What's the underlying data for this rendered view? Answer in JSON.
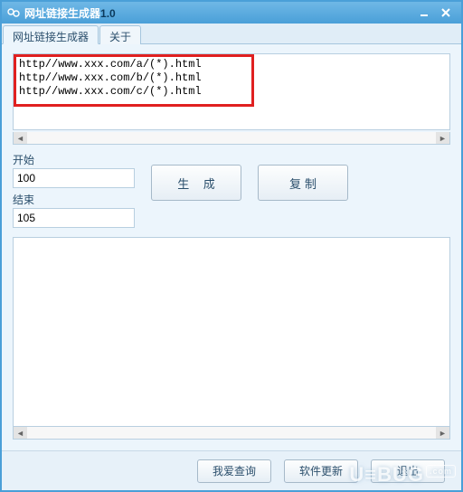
{
  "window": {
    "title_name": "网址链接生成器",
    "title_version": "1.0"
  },
  "tabs": [
    {
      "label": "网址链接生成器",
      "active": true
    },
    {
      "label": "关于",
      "active": false
    }
  ],
  "templates": {
    "text": "http//www.xxx.com/a/(*).html\nhttp//www.xxx.com/b/(*).html\nhttp//www.xxx.com/c/(*).html"
  },
  "range": {
    "start_label": "开始",
    "start_value": "100",
    "end_label": "结束",
    "end_value": "105"
  },
  "buttons": {
    "generate": "生 成",
    "copy": "复制",
    "query": "我爱查询",
    "update": "软件更新",
    "exit": "退出"
  },
  "output": {
    "text": ""
  },
  "watermark": {
    "brand": "U≡BUG",
    "tld": ".com"
  }
}
